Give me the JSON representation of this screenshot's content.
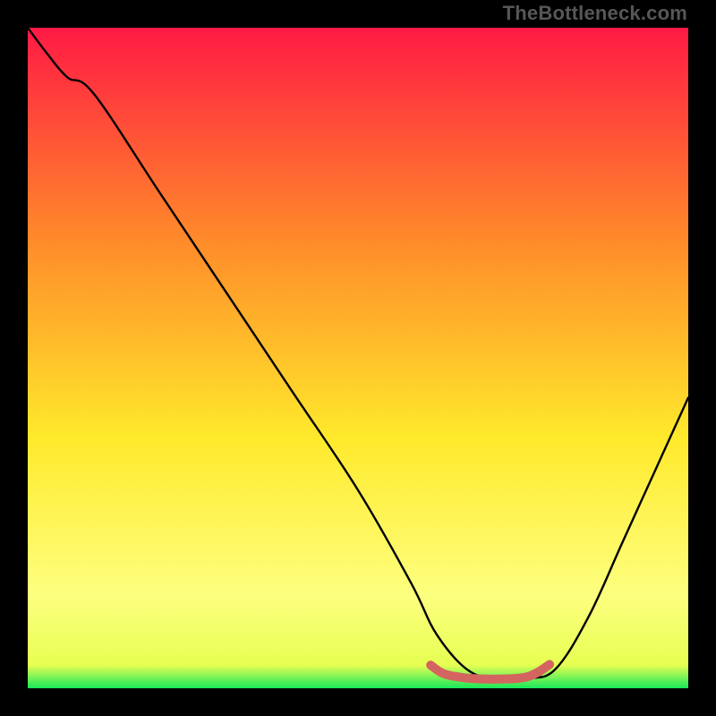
{
  "watermark": "TheBottleneck.com",
  "colors": {
    "frame": "#000000",
    "grad_top": "#ff1a44",
    "grad_mid1": "#ff8a2a",
    "grad_mid2": "#ffe92b",
    "grad_low": "#fdff7f",
    "grad_bottom": "#18e85a",
    "curve": "#000000",
    "valley_marker": "#d4645f"
  },
  "chart_data": {
    "type": "line",
    "title": "",
    "xlabel": "",
    "ylabel": "",
    "xlim": [
      0,
      100
    ],
    "ylim": [
      0,
      100
    ],
    "series": [
      {
        "name": "bottleneck-curve",
        "x": [
          0,
          3,
          6,
          10,
          20,
          30,
          40,
          50,
          58,
          62,
          67,
          72,
          76,
          80,
          85,
          90,
          95,
          100
        ],
        "y": [
          100,
          96,
          92.5,
          90,
          75,
          60,
          45,
          30,
          16,
          8,
          2.5,
          1.5,
          1.5,
          3,
          11,
          22,
          33,
          44
        ]
      },
      {
        "name": "valley-marker",
        "x": [
          61,
          63,
          66,
          69,
          72,
          75,
          77,
          79
        ],
        "y": [
          3.5,
          2.2,
          1.6,
          1.4,
          1.4,
          1.6,
          2.3,
          3.6
        ]
      }
    ],
    "gradient_stops": [
      {
        "pct": 0,
        "color": "#ff1a44"
      },
      {
        "pct": 32,
        "color": "#ff8a2a"
      },
      {
        "pct": 62,
        "color": "#ffe92b"
      },
      {
        "pct": 86,
        "color": "#fdff7f"
      },
      {
        "pct": 96.5,
        "color": "#e6ff52"
      },
      {
        "pct": 100,
        "color": "#18e85a"
      }
    ]
  }
}
